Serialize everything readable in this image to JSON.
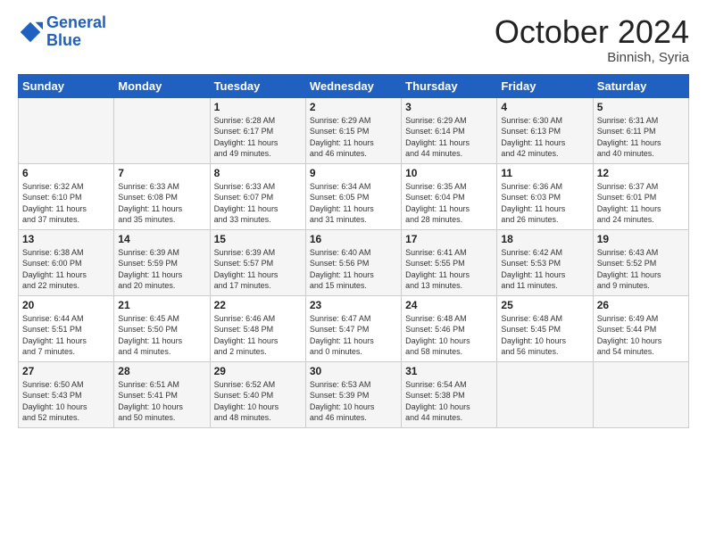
{
  "header": {
    "logo_line1": "General",
    "logo_line2": "Blue",
    "month_title": "October 2024",
    "subtitle": "Binnish, Syria"
  },
  "weekdays": [
    "Sunday",
    "Monday",
    "Tuesday",
    "Wednesday",
    "Thursday",
    "Friday",
    "Saturday"
  ],
  "weeks": [
    [
      {
        "day": "",
        "info": ""
      },
      {
        "day": "",
        "info": ""
      },
      {
        "day": "1",
        "info": "Sunrise: 6:28 AM\nSunset: 6:17 PM\nDaylight: 11 hours\nand 49 minutes."
      },
      {
        "day": "2",
        "info": "Sunrise: 6:29 AM\nSunset: 6:15 PM\nDaylight: 11 hours\nand 46 minutes."
      },
      {
        "day": "3",
        "info": "Sunrise: 6:29 AM\nSunset: 6:14 PM\nDaylight: 11 hours\nand 44 minutes."
      },
      {
        "day": "4",
        "info": "Sunrise: 6:30 AM\nSunset: 6:13 PM\nDaylight: 11 hours\nand 42 minutes."
      },
      {
        "day": "5",
        "info": "Sunrise: 6:31 AM\nSunset: 6:11 PM\nDaylight: 11 hours\nand 40 minutes."
      }
    ],
    [
      {
        "day": "6",
        "info": "Sunrise: 6:32 AM\nSunset: 6:10 PM\nDaylight: 11 hours\nand 37 minutes."
      },
      {
        "day": "7",
        "info": "Sunrise: 6:33 AM\nSunset: 6:08 PM\nDaylight: 11 hours\nand 35 minutes."
      },
      {
        "day": "8",
        "info": "Sunrise: 6:33 AM\nSunset: 6:07 PM\nDaylight: 11 hours\nand 33 minutes."
      },
      {
        "day": "9",
        "info": "Sunrise: 6:34 AM\nSunset: 6:05 PM\nDaylight: 11 hours\nand 31 minutes."
      },
      {
        "day": "10",
        "info": "Sunrise: 6:35 AM\nSunset: 6:04 PM\nDaylight: 11 hours\nand 28 minutes."
      },
      {
        "day": "11",
        "info": "Sunrise: 6:36 AM\nSunset: 6:03 PM\nDaylight: 11 hours\nand 26 minutes."
      },
      {
        "day": "12",
        "info": "Sunrise: 6:37 AM\nSunset: 6:01 PM\nDaylight: 11 hours\nand 24 minutes."
      }
    ],
    [
      {
        "day": "13",
        "info": "Sunrise: 6:38 AM\nSunset: 6:00 PM\nDaylight: 11 hours\nand 22 minutes."
      },
      {
        "day": "14",
        "info": "Sunrise: 6:39 AM\nSunset: 5:59 PM\nDaylight: 11 hours\nand 20 minutes."
      },
      {
        "day": "15",
        "info": "Sunrise: 6:39 AM\nSunset: 5:57 PM\nDaylight: 11 hours\nand 17 minutes."
      },
      {
        "day": "16",
        "info": "Sunrise: 6:40 AM\nSunset: 5:56 PM\nDaylight: 11 hours\nand 15 minutes."
      },
      {
        "day": "17",
        "info": "Sunrise: 6:41 AM\nSunset: 5:55 PM\nDaylight: 11 hours\nand 13 minutes."
      },
      {
        "day": "18",
        "info": "Sunrise: 6:42 AM\nSunset: 5:53 PM\nDaylight: 11 hours\nand 11 minutes."
      },
      {
        "day": "19",
        "info": "Sunrise: 6:43 AM\nSunset: 5:52 PM\nDaylight: 11 hours\nand 9 minutes."
      }
    ],
    [
      {
        "day": "20",
        "info": "Sunrise: 6:44 AM\nSunset: 5:51 PM\nDaylight: 11 hours\nand 7 minutes."
      },
      {
        "day": "21",
        "info": "Sunrise: 6:45 AM\nSunset: 5:50 PM\nDaylight: 11 hours\nand 4 minutes."
      },
      {
        "day": "22",
        "info": "Sunrise: 6:46 AM\nSunset: 5:48 PM\nDaylight: 11 hours\nand 2 minutes."
      },
      {
        "day": "23",
        "info": "Sunrise: 6:47 AM\nSunset: 5:47 PM\nDaylight: 11 hours\nand 0 minutes."
      },
      {
        "day": "24",
        "info": "Sunrise: 6:48 AM\nSunset: 5:46 PM\nDaylight: 10 hours\nand 58 minutes."
      },
      {
        "day": "25",
        "info": "Sunrise: 6:48 AM\nSunset: 5:45 PM\nDaylight: 10 hours\nand 56 minutes."
      },
      {
        "day": "26",
        "info": "Sunrise: 6:49 AM\nSunset: 5:44 PM\nDaylight: 10 hours\nand 54 minutes."
      }
    ],
    [
      {
        "day": "27",
        "info": "Sunrise: 6:50 AM\nSunset: 5:43 PM\nDaylight: 10 hours\nand 52 minutes."
      },
      {
        "day": "28",
        "info": "Sunrise: 6:51 AM\nSunset: 5:41 PM\nDaylight: 10 hours\nand 50 minutes."
      },
      {
        "day": "29",
        "info": "Sunrise: 6:52 AM\nSunset: 5:40 PM\nDaylight: 10 hours\nand 48 minutes."
      },
      {
        "day": "30",
        "info": "Sunrise: 6:53 AM\nSunset: 5:39 PM\nDaylight: 10 hours\nand 46 minutes."
      },
      {
        "day": "31",
        "info": "Sunrise: 6:54 AM\nSunset: 5:38 PM\nDaylight: 10 hours\nand 44 minutes."
      },
      {
        "day": "",
        "info": ""
      },
      {
        "day": "",
        "info": ""
      }
    ]
  ]
}
